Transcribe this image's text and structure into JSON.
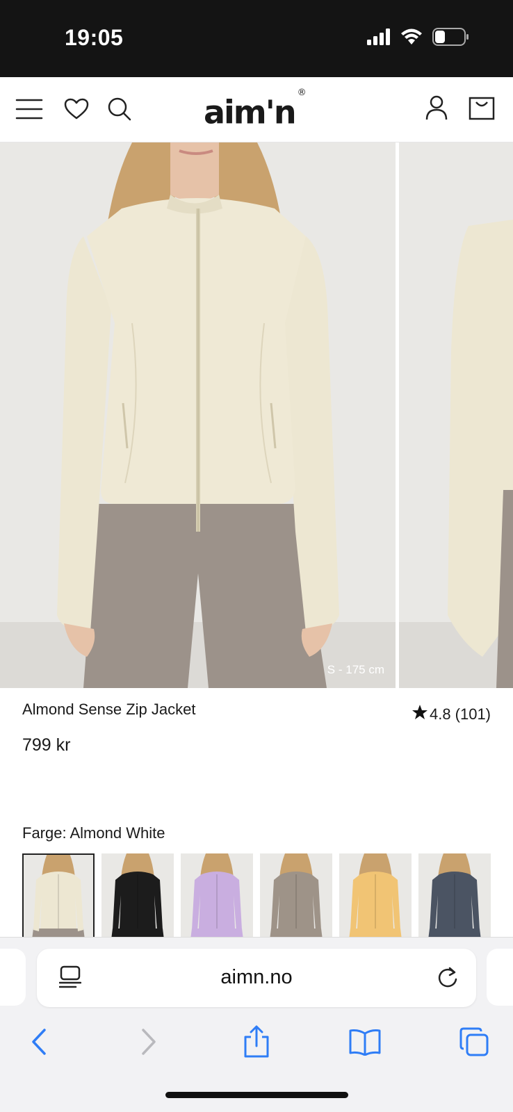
{
  "status_bar": {
    "time": "19:05",
    "icons": [
      "cellular-signal-icon",
      "wifi-icon",
      "battery-icon"
    ]
  },
  "header": {
    "icons": [
      "hamburger-menu-icon",
      "heart-icon",
      "search-icon",
      "account-icon",
      "cart-icon"
    ],
    "logo_text": "aim'n",
    "logo_mark": "®"
  },
  "gallery": {
    "size_caption": "S - 175 cm",
    "colors": {
      "jacket": "#ede7d2",
      "leggings": "#9c928a",
      "background": "#e9e8e5"
    }
  },
  "product": {
    "title": "Almond Sense Zip Jacket",
    "rating_value": "4.8",
    "rating_count": "(101)",
    "price": "799 kr",
    "color_label": "Farge: Almond White"
  },
  "swatches": [
    {
      "color": "#ede7d2",
      "bottom": "#9c928a",
      "selected": true
    },
    {
      "color": "#1c1c1c",
      "bottom": "#1c1c1c",
      "selected": false
    },
    {
      "color": "#c9aee0",
      "bottom": "#c9aee0",
      "selected": false
    },
    {
      "color": "#9e9388",
      "bottom": "#9e9388",
      "selected": false
    },
    {
      "color": "#f1c474",
      "bottom": "#f1c474",
      "selected": false
    },
    {
      "color": "#4b5463",
      "bottom": "#4b5463",
      "selected": false
    }
  ],
  "browser": {
    "url": "aimn.no",
    "accent_color": "#2f7df6",
    "icons": [
      "reader-mode-icon",
      "reload-icon",
      "back-icon",
      "forward-icon",
      "share-icon",
      "bookmarks-icon",
      "tabs-icon"
    ]
  }
}
